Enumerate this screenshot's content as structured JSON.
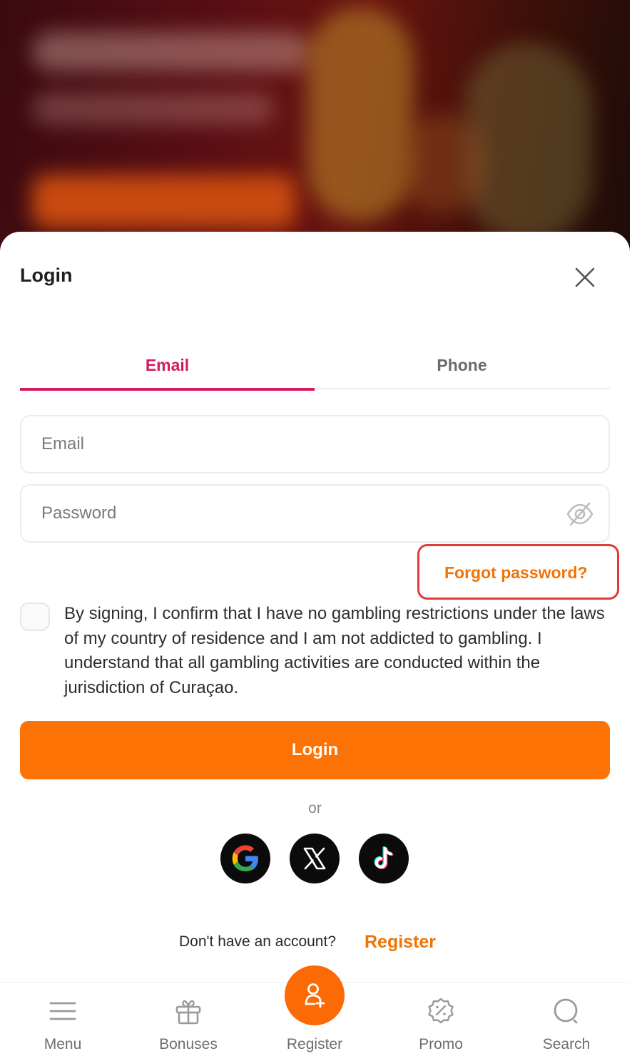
{
  "modal": {
    "title": "Login",
    "tabs": [
      {
        "label": "Email",
        "active": true
      },
      {
        "label": "Phone",
        "active": false
      }
    ],
    "email_field": {
      "placeholder": "Email",
      "value": ""
    },
    "password_field": {
      "placeholder": "Password",
      "value": ""
    },
    "forgot_password": "Forgot password?",
    "consent_text": "By signing, I confirm that I have no gambling restrictions under the laws of my country of residence and I am not addicted to gambling. I understand that all gambling activities are conducted within the jurisdiction of Curaçao.",
    "consent_checked": false,
    "login_button": "Login",
    "or_text": "or",
    "social_logins": [
      "google-icon",
      "x-icon",
      "tiktok-icon"
    ],
    "no_account_text": "Don't have an account?",
    "register_link": "Register"
  },
  "bottom_nav": {
    "items": [
      {
        "label": "Menu",
        "icon": "hamburger-menu-icon"
      },
      {
        "label": "Bonuses",
        "icon": "gift-icon"
      },
      {
        "label": "Register",
        "icon": "add-user-icon"
      },
      {
        "label": "Promo",
        "icon": "promo-badge-icon"
      },
      {
        "label": "Search",
        "icon": "search-icon"
      }
    ]
  },
  "colors": {
    "accent_tab": "#d41a62",
    "primary_button": "#fc7205",
    "link_orange": "#f07306",
    "highlight_border": "#e23a3a"
  }
}
